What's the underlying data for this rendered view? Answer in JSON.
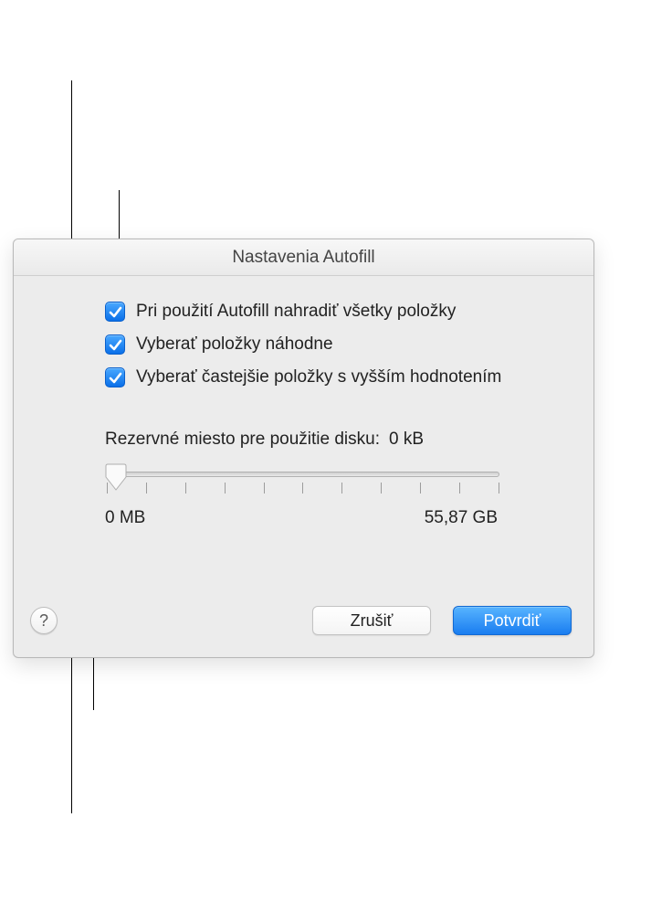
{
  "dialog": {
    "title": "Nastavenia Autofill"
  },
  "options": [
    {
      "label": "Pri použití Autofill nahradiť všetky položky",
      "checked": true
    },
    {
      "label": "Vyberať položky náhodne",
      "checked": true
    },
    {
      "label": "Vyberať častejšie položky s vyšším hodnotením",
      "checked": true
    }
  ],
  "reserve": {
    "label": "Rezervné miesto pre použitie disku:",
    "value": "0 kB",
    "min": "0 MB",
    "max": "55,87 GB"
  },
  "footer": {
    "help": "?",
    "cancel": "Zrušiť",
    "confirm": "Potvrdiť"
  }
}
